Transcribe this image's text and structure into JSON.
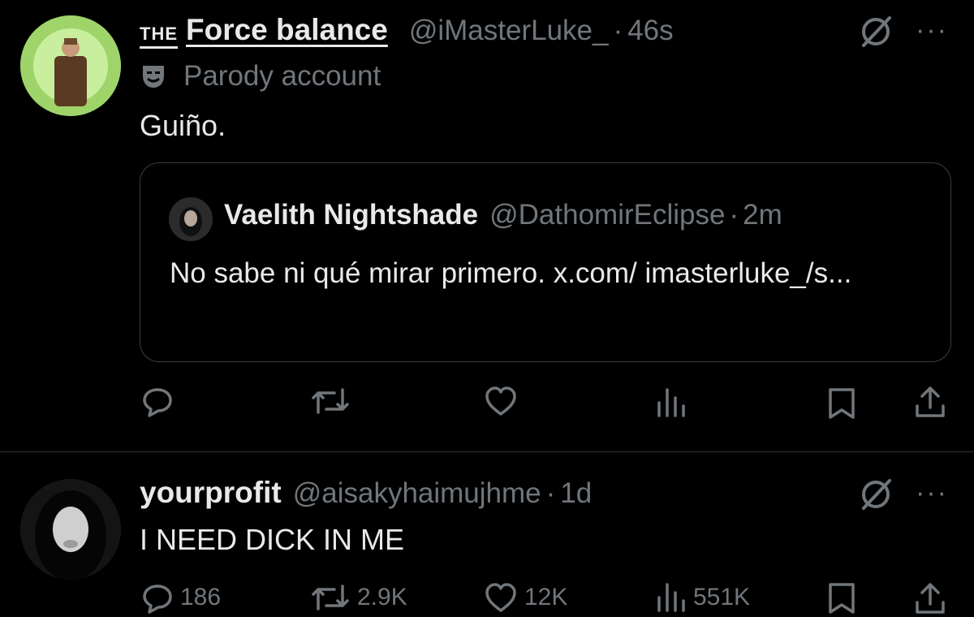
{
  "tweet1": {
    "name_prefix": "THE",
    "name": "Force balance",
    "handle": "@iMasterLuke_",
    "time": "46s",
    "separator": "·",
    "parody_label": "Parody account",
    "text": "Guiño.",
    "quote": {
      "name": "Vaelith Nightshade",
      "handle": "@DathomirEclipse",
      "time": "2m",
      "separator": "·",
      "text": "No sabe ni qué mirar primero. x.com/ imasterluke_/s..."
    },
    "actions": {
      "reply": "",
      "retweet": "",
      "like": "",
      "views": ""
    }
  },
  "tweet2": {
    "name": "yourprofit",
    "handle": "@aisakyhaimujhme",
    "time": "1d",
    "separator": "·",
    "text": "I NEED DICK IN ME",
    "actions": {
      "reply": "186",
      "retweet": "2.9K",
      "like": "12K",
      "views": "551K"
    }
  },
  "more_label": "···",
  "colors": {
    "background": "#000000",
    "text": "#e7e9ea",
    "muted": "#71767b",
    "border": "#2f3336",
    "avatar_ring": "#9ed46a"
  },
  "icons": [
    "grok-icon",
    "more-icon",
    "reply-icon",
    "retweet-icon",
    "like-icon",
    "views-icon",
    "bookmark-icon",
    "share-icon",
    "parody-mask-icon"
  ]
}
